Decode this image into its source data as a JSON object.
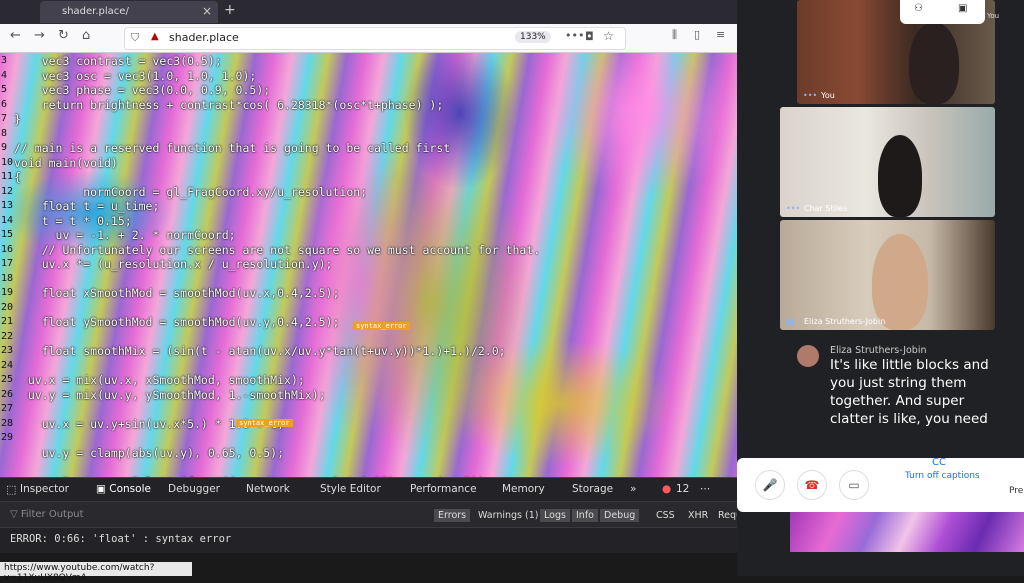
{
  "browser": {
    "tab_title": "shader.place/",
    "tab_close": "×",
    "new_tab": "+",
    "url": "shader.place",
    "zoom": "133%",
    "nav_back": "←",
    "nav_forward": "→",
    "nav_reload": "↻",
    "nav_home": "⌂",
    "menu_dots": "•••"
  },
  "editor": {
    "line_numbers": [
      "3",
      "4",
      "5",
      "6",
      "7",
      "8",
      "9",
      "10",
      "11",
      "12",
      "13",
      "14",
      "15",
      "16",
      "17",
      "18",
      "19",
      "20",
      "21",
      "22",
      "23",
      "24",
      "25",
      "26",
      "27",
      "28",
      "29"
    ],
    "lines": [
      "    vec3 contrast = vec3(0.5);",
      "    vec3 osc = vec3(1.0, 1.0, 1.0);",
      "    vec3 phase = vec3(0.0, 0.9, 0.5);",
      "    return brightness + contrast*cos( 6.28318*(osc*t+phase) );",
      "}",
      "",
      "// main is a reserved function that is going to be called first",
      "void main(void)",
      "{",
      "          normCoord = gl_FragCoord.xy/u_resolution;",
      "    float t = u_time;",
      "    t = t * 0.15;",
      "      uv = -1. + 2. * normCoord;",
      "    // Unfortunately our screens are not square so we must account for that.",
      "    uv.x *= (u_resolution.x / u_resolution.y);",
      "",
      "    float xSmoothMod = smoothMod(uv.x,0.4,2.5);",
      "",
      "    float ySmoothMod = smoothMod(uv.y,0.4,2.5);",
      "",
      "    float smoothMix = (sin(t - atan(uv.x/uv.y*tan(t+uv.y))*1.)+1.)/2.0;",
      "",
      "  uv.x = mix(uv.x, xSmoothMod, smoothMix);",
      "  uv.y = mix(uv.y, ySmoothMod, 1.-smoothMix);",
      "",
      "    uv.x = uv.y+sin(uv.x*5.) * 1.0 + t;",
      "",
      "    uv.y = clamp(abs(uv.y), 0.65, 0.5);",
      "",
      "    vec3 co = cosPalette(fract((uv.x/uv.y+uv.x) * 0.25) + cos(t*.3));"
    ],
    "error_tags": [
      "syntax_error",
      "syntax_error"
    ]
  },
  "devtools": {
    "tabs": [
      "Inspector",
      "Console",
      "Debugger",
      "Network",
      "Style Editor",
      "Performance",
      "Memory",
      "Storage",
      "»"
    ],
    "error_count": "12",
    "filter_placeholder": "Filter Output",
    "filters": [
      "Errors",
      "Warnings (1)",
      "Logs",
      "Info",
      "Debug",
      "CSS",
      "XHR",
      "Requests"
    ],
    "error_message": "ERROR: 0:66: 'float' : syntax error"
  },
  "status_url": "https://www.youtube.com/watch?v=11XuUX8QVmA",
  "meet": {
    "top_controls": [
      "⚇",
      "▣"
    ],
    "top_you": "You",
    "participants": [
      {
        "name": "You"
      },
      {
        "name": "Char Stiles"
      },
      {
        "name": "Eliza Struthers-Jobin"
      }
    ],
    "caption": {
      "speaker": "Eliza Struthers-Jobin",
      "text": "It's like little blocks and you just string them together. And super clatter is like, you need"
    },
    "controls": {
      "mic": "🎤",
      "hangup": "☎",
      "camera": "▭",
      "captions_label": "Turn off captions",
      "present_label": "Pre"
    }
  }
}
